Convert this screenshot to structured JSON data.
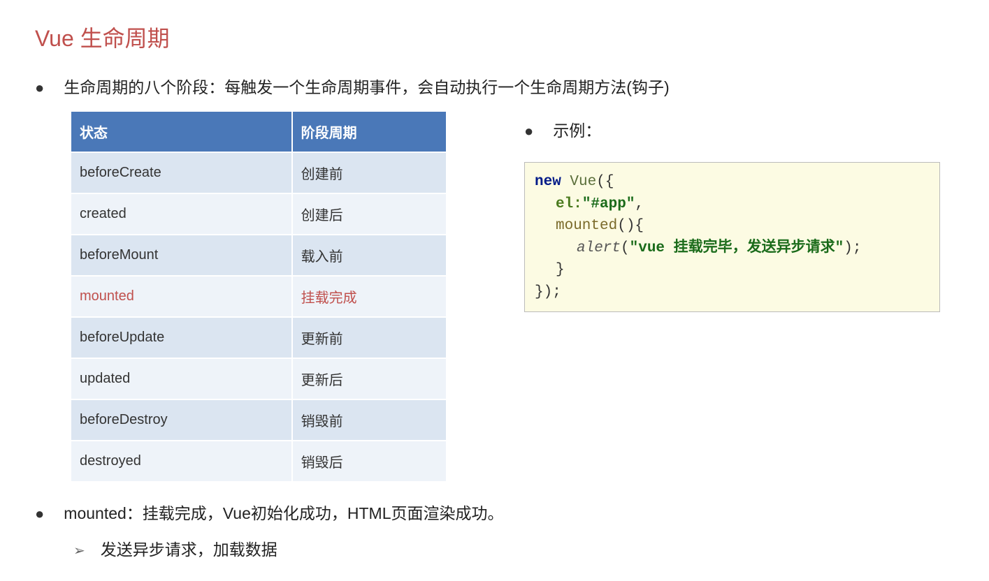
{
  "title": "Vue 生命周期",
  "intro": "生命周期的八个阶段：每触发一个生命周期事件，会自动执行一个生命周期方法(钩子)",
  "table": {
    "headers": [
      "状态",
      "阶段周期"
    ],
    "rows": [
      {
        "state": "beforeCreate",
        "phase": "创建前",
        "highlight": false
      },
      {
        "state": "created",
        "phase": "创建后",
        "highlight": false
      },
      {
        "state": "beforeMount",
        "phase": "载入前",
        "highlight": false
      },
      {
        "state": "mounted",
        "phase": "挂载完成",
        "highlight": true
      },
      {
        "state": "beforeUpdate",
        "phase": "更新前",
        "highlight": false
      },
      {
        "state": "updated",
        "phase": "更新后",
        "highlight": false
      },
      {
        "state": "beforeDestroy",
        "phase": "销毁前",
        "highlight": false
      },
      {
        "state": "destroyed",
        "phase": "销毁后",
        "highlight": false
      }
    ]
  },
  "example_label": "示例：",
  "code": {
    "kw_new": "new",
    "kw_vue": "Vue",
    "open": "({",
    "el_key": "el:",
    "el_val": "\"#app\"",
    "comma": ",",
    "mounted_key": "mounted",
    "mounted_paren": "(){",
    "alert_fn": "alert",
    "alert_open": "(",
    "alert_msg": "\"vue 挂载完毕，发送异步请求\"",
    "alert_close": ");",
    "close_brace": "}",
    "close_all": "});"
  },
  "mounted_desc": "mounted：挂载完成，Vue初始化成功，HTML页面渲染成功。",
  "sub_point": "发送异步请求，加载数据"
}
